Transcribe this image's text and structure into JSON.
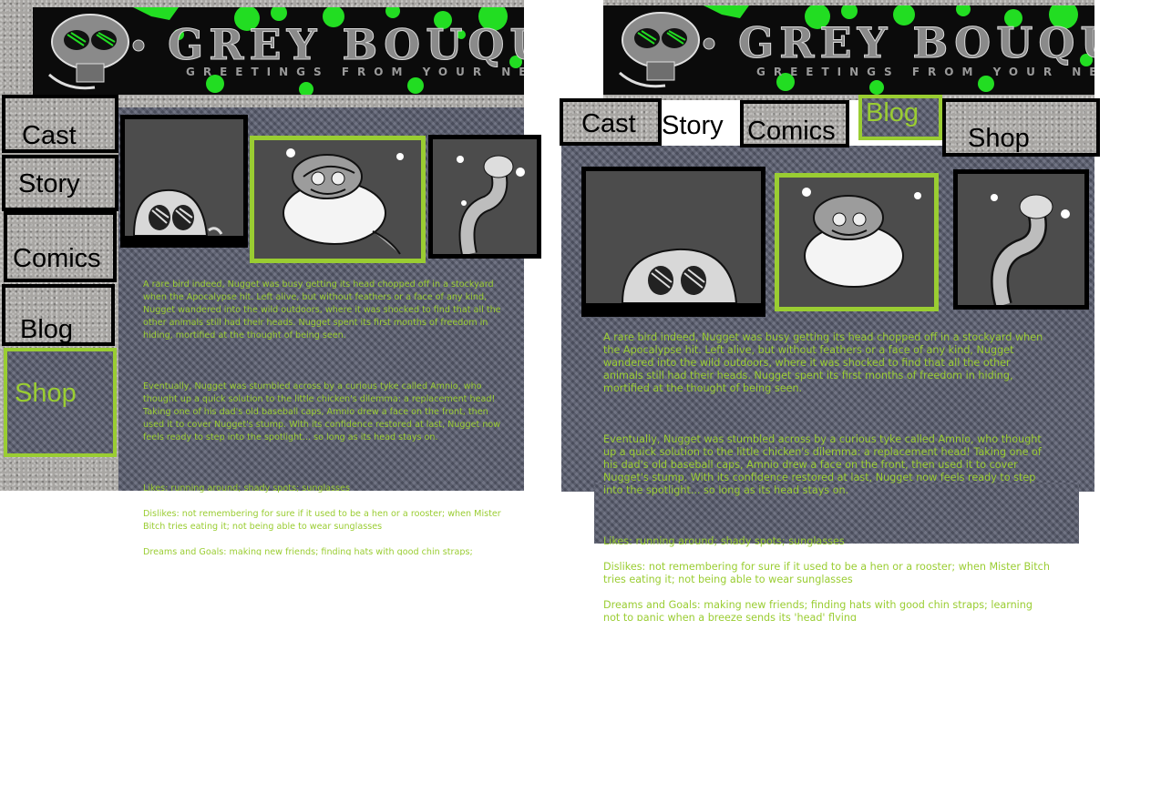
{
  "site": {
    "title": "GREY BOUQU",
    "tagline": "GREETINGS FROM YOUR NEW T"
  },
  "nav": {
    "cast": "Cast",
    "story": "Story",
    "comics": "Comics",
    "blog": "Blog",
    "shop": "Shop"
  },
  "character": {
    "bio": "A rare bird indeed, Nugget was busy getting its head chopped off in a stockyard when the Apocalypse hit. Left alive, but without feathers or a face of any kind, Nugget wandered into the wild outdoors, where it was shocked to find that all the other animals still had their heads. Nugget spent its first months of freedom in hiding, mortified at the thought of being seen.",
    "origin": "Eventually, Nugget was stumbled across by a curious tyke called Amnio, who thought up a quick solution to the little chicken's dilemma: a replacement head! Taking one of his dad's old baseball caps, Amnio drew a face on the front, then used it to cover Nugget's stump. With its confidence restored at last, Nugget now feels ready to step into the spotlight... so long as its head stays on.",
    "likes": "Likes: running around; shady spots; sunglasses",
    "dislikes": "Dislikes: not remembering for sure if it used to be a hen or a rooster; when Mister Bitch tries eating it; not being able to wear sunglasses",
    "dreams": "Dreams and Goals: making new friends; finding hats with good chin straps; learning not to panic when a breeze sends its 'head' flying"
  },
  "colors": {
    "accent_green": "#9acd32",
    "splat_green": "#22dd22",
    "panel_grey": "#4c4c4c"
  }
}
